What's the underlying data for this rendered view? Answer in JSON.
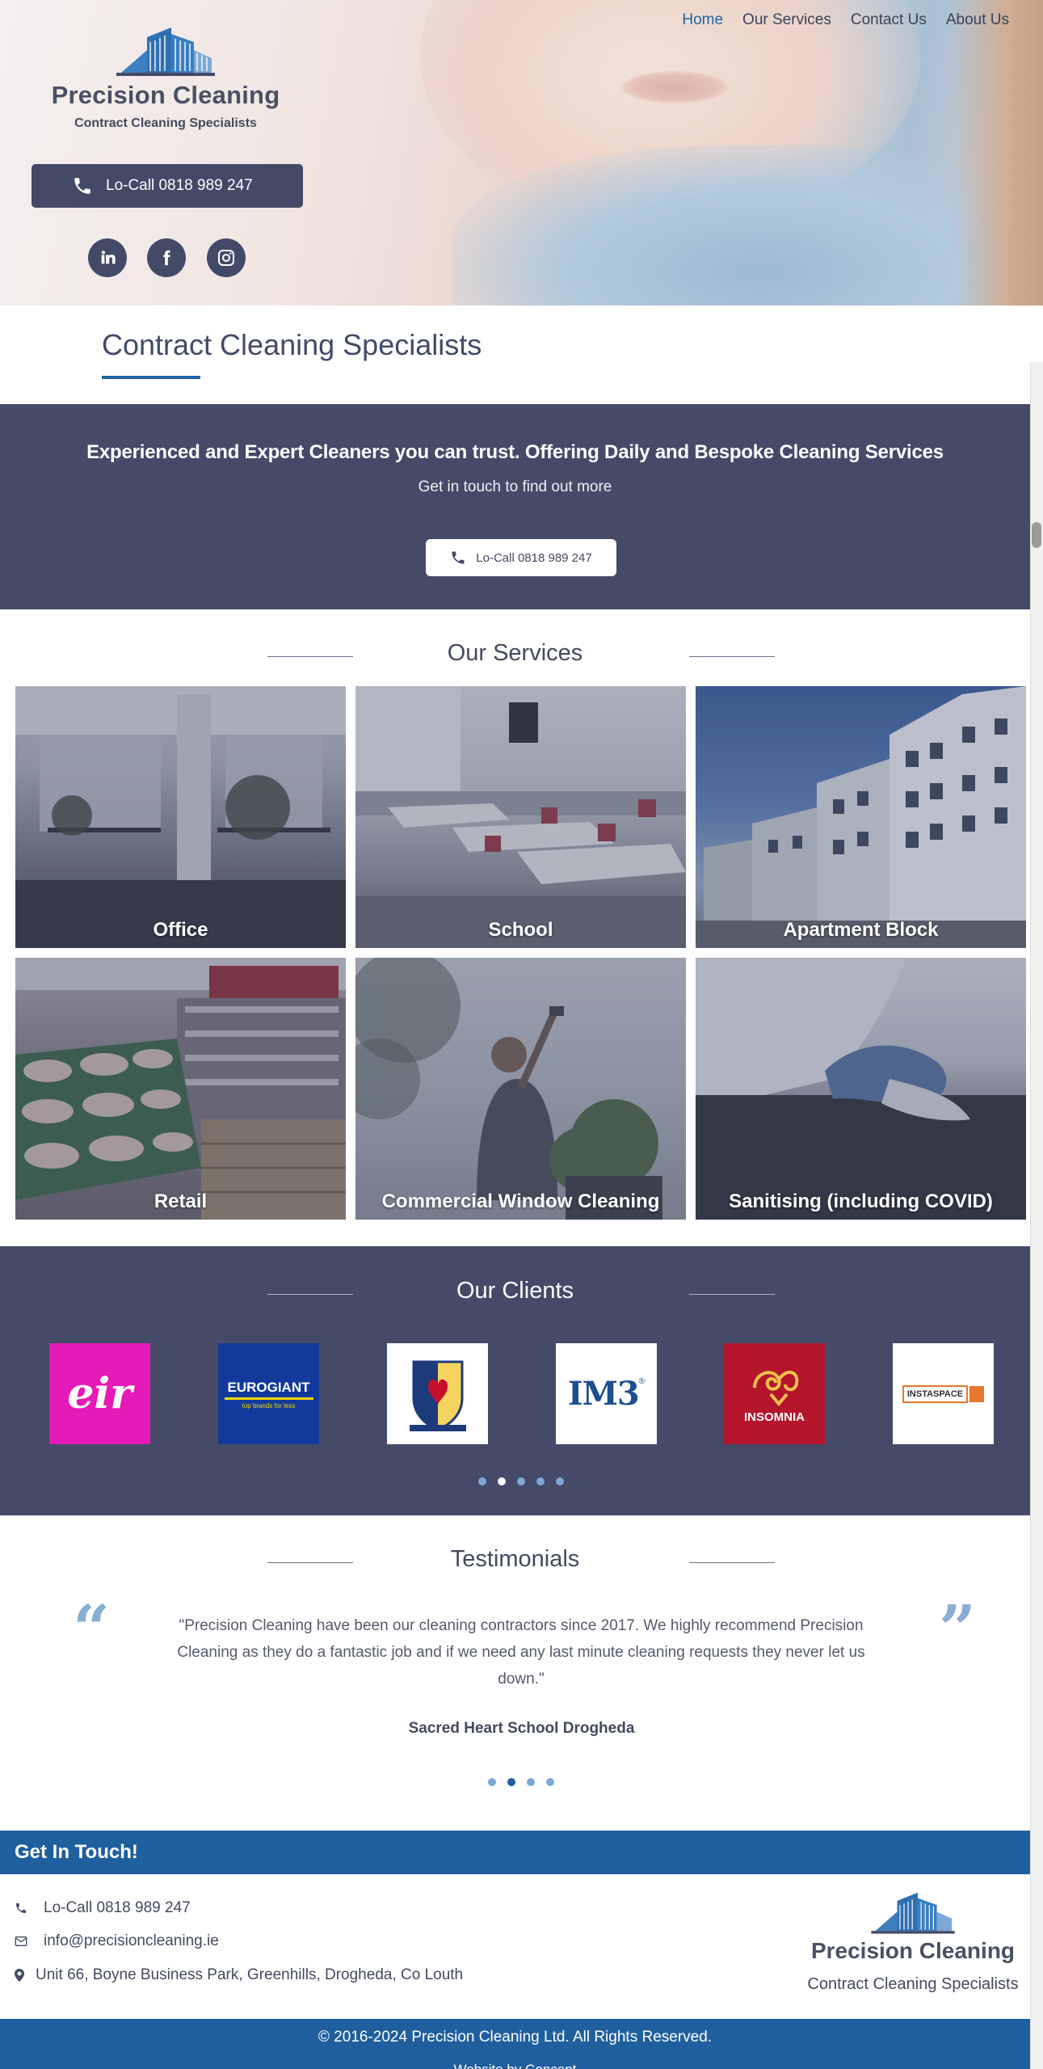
{
  "brand": {
    "name": "Precision Cleaning",
    "tagline": "Contract Cleaning Specialists",
    "accent_color": "#1f63a0",
    "dark_color": "#444a68"
  },
  "nav": {
    "items": [
      {
        "label": "Home",
        "active": true
      },
      {
        "label": "Our Services",
        "active": false
      },
      {
        "label": "Contact Us",
        "active": false
      },
      {
        "label": "About Us",
        "active": false
      }
    ]
  },
  "hero": {
    "call_label": "Lo-Call 0818 989 247",
    "socials": [
      "linkedin-icon",
      "facebook-icon",
      "instagram-icon"
    ]
  },
  "page_title": "Contract Cleaning Specialists",
  "banner": {
    "headline": "Experienced and Expert Cleaners you can trust. Offering Daily and Bespoke Cleaning Services",
    "subtext": "Get in touch to find out more",
    "button_label": "Lo-Call 0818 989 247"
  },
  "services": {
    "heading": "Our Services",
    "items": [
      {
        "label": "Office"
      },
      {
        "label": "School"
      },
      {
        "label": "Apartment Block"
      },
      {
        "label": "Retail"
      },
      {
        "label": "Commercial Window Cleaning"
      },
      {
        "label": "Sanitising (including COVID)"
      }
    ]
  },
  "clients": {
    "heading": "Our Clients",
    "logos": [
      {
        "name": "eir",
        "text": "eir"
      },
      {
        "name": "eurogiant",
        "text": "EUROGIANT",
        "tagline": "top brands for less"
      },
      {
        "name": "school-crest",
        "text": ""
      },
      {
        "name": "im3",
        "text": "IM3",
        "mark": "®"
      },
      {
        "name": "insomnia",
        "text": "INSOMNIA"
      },
      {
        "name": "instaspace",
        "text": "INSTASPACE"
      }
    ],
    "active_dot": 1,
    "dot_count": 5
  },
  "testimonials": {
    "heading": "Testimonials",
    "quote": "\"Precision Cleaning have been our cleaning contractors since 2017. We highly recommend Precision Cleaning as they do a fantastic job and if we need any last minute cleaning requests they never let us down.\"",
    "author": "Sacred Heart School Drogheda",
    "active_dot": 1,
    "dot_count": 4
  },
  "contact": {
    "heading": "Get In Touch!",
    "phone": "Lo-Call 0818 989 247",
    "email": "info@precisioncleaning.ie",
    "address": "Unit 66, Boyne Business Park, Greenhills, Drogheda, Co Louth"
  },
  "footer": {
    "copyright": "© 2016-2024 Precision Cleaning Ltd. All Rights Reserved.",
    "credit": "Website by Concept"
  }
}
